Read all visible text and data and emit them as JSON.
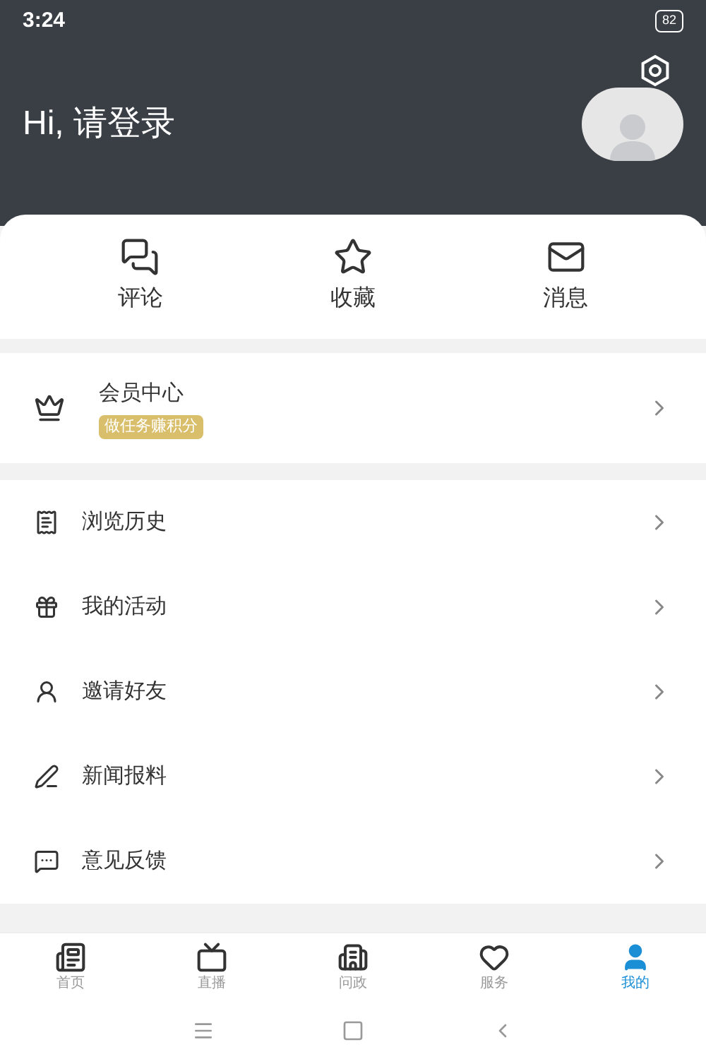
{
  "status_bar": {
    "time": "3:24",
    "battery": "82"
  },
  "header": {
    "greeting": "Hi, 请登录"
  },
  "actions": [
    {
      "kind": "comment",
      "label": "评论"
    },
    {
      "kind": "star",
      "label": "收藏"
    },
    {
      "kind": "mail",
      "label": "消息"
    }
  ],
  "member": {
    "title": "会员中心",
    "badge": "做任务赚积分"
  },
  "menu": [
    {
      "kind": "history",
      "label": "浏览历史"
    },
    {
      "kind": "gift",
      "label": "我的活动"
    },
    {
      "kind": "invite",
      "label": "邀请好友"
    },
    {
      "kind": "report",
      "label": "新闻报料"
    },
    {
      "kind": "feedback",
      "label": "意见反馈"
    }
  ],
  "tabs": [
    {
      "kind": "home",
      "label": "首页",
      "selected": false
    },
    {
      "kind": "live",
      "label": "直播",
      "selected": false
    },
    {
      "kind": "gov",
      "label": "问政",
      "selected": false
    },
    {
      "kind": "service",
      "label": "服务",
      "selected": false
    },
    {
      "kind": "me",
      "label": "我的",
      "selected": true
    }
  ]
}
